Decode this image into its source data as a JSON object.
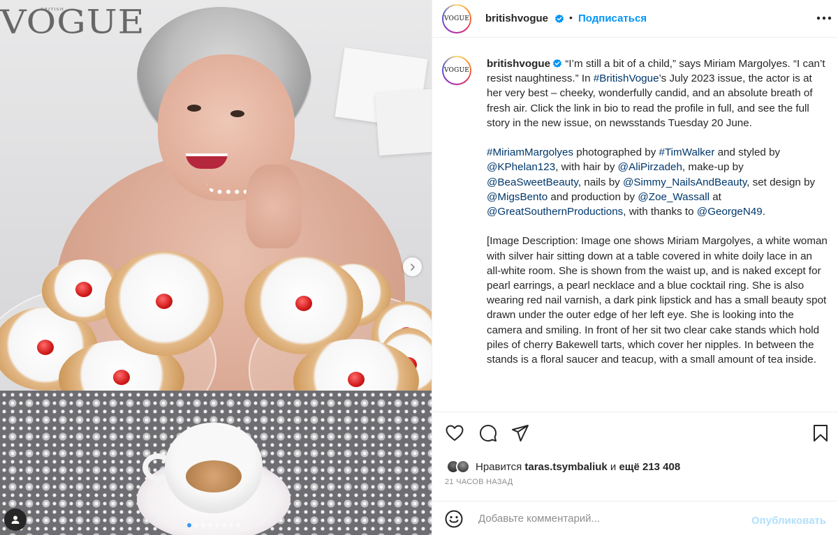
{
  "photo": {
    "logo_text": "VOGUE",
    "logo_small": "BRITISH",
    "carousel_total": 8,
    "carousel_active": 1
  },
  "header": {
    "username": "britishvogue",
    "avatar_text": "VOGUE",
    "separator": "•",
    "follow_label": "Подписаться",
    "more_icon": "more-horizontal-icon"
  },
  "caption": {
    "username": "britishvogue",
    "avatar_text": "VOGUE",
    "segments": [
      {
        "t": "“I’m still a bit of a child,” says Miriam Margolyes. “I can’t resist naughtiness.” In "
      },
      {
        "t": "#BritishVogue",
        "link": true
      },
      {
        "t": "’s July 2023 issue, the actor is at her very best – cheeky, wonderfully candid, and an absolute breath of fresh air. Click the link in bio to read the profile in full, and see the full story in the new issue, on newsstands Tuesday 20 June.\n\n"
      },
      {
        "t": "#MiriamMargolyes",
        "link": true
      },
      {
        "t": " photographed by "
      },
      {
        "t": "#TimWalker",
        "link": true
      },
      {
        "t": " and styled by "
      },
      {
        "t": "@KPhelan123",
        "link": true
      },
      {
        "t": ", with hair by "
      },
      {
        "t": "@AliPirzadeh",
        "link": true
      },
      {
        "t": ", make-up by "
      },
      {
        "t": "@BeaSweetBeauty",
        "link": true
      },
      {
        "t": ", nails by "
      },
      {
        "t": "@Simmy_NailsAndBeauty",
        "link": true
      },
      {
        "t": ", set design by "
      },
      {
        "t": "@MigsBento",
        "link": true
      },
      {
        "t": " and production by "
      },
      {
        "t": "@Zoe_Wassall",
        "link": true
      },
      {
        "t": " at "
      },
      {
        "t": "@GreatSouthernProductions",
        "link": true
      },
      {
        "t": ", with thanks to "
      },
      {
        "t": "@GeorgeN49",
        "link": true
      },
      {
        "t": ".\n\n[Image Description: Image one shows Miriam Margolyes, a white woman with silver hair sitting down at a table covered in white doily lace in an all-white room. She is shown from the waist up, and is naked except for pearl earrings, a pearl necklace and a blue cocktail ring. She is also wearing red nail varnish, a dark pink lipstick and has a small beauty spot drawn under the outer edge of her left eye. She is looking into the camera and smiling. In front of her sit two clear cake stands which hold piles of cherry Bakewell tarts, which cover her nipples. In between the stands is a floral saucer and teacup, with a small amount of tea inside."
      }
    ]
  },
  "actions": {
    "like_icon": "heart-icon",
    "comment_icon": "comment-icon",
    "share_icon": "share-icon",
    "save_icon": "bookmark-icon",
    "likes_prefix": "Нравится ",
    "likes_user": "taras.tsymbaliuk",
    "likes_mid": " и ",
    "likes_rest": "ещё 213 408",
    "time": "21 ЧАСОВ НАЗАД"
  },
  "comment": {
    "emoji_icon": "emoji-icon",
    "placeholder": "Добавьте комментарий...",
    "publish_label": "Опубликовать"
  },
  "colors": {
    "link": "#00376b",
    "follow": "#0095f6",
    "verified": "#0095f6",
    "publish_disabled": "#b2dffc",
    "muted": "#8e8e8e"
  }
}
